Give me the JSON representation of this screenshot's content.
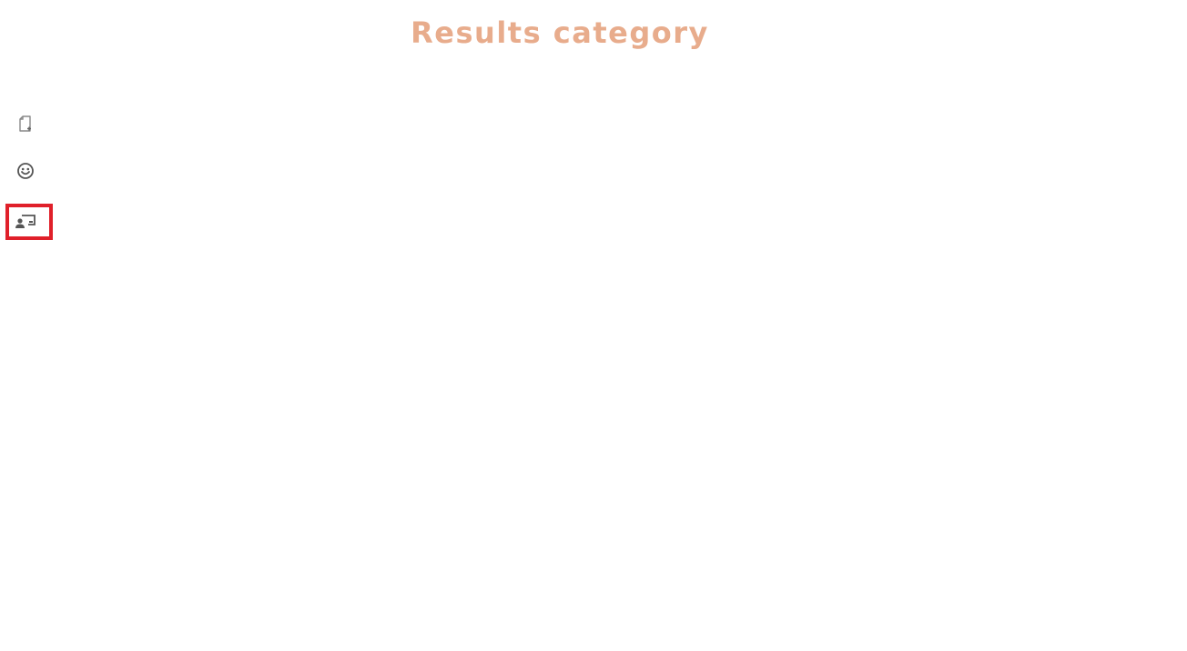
{
  "header": {
    "title": "Results category"
  },
  "sidebar": {
    "items": [
      {
        "id": "new-document",
        "icon": "new-document-icon"
      },
      {
        "id": "emoji",
        "icon": "smiley-icon"
      },
      {
        "id": "presenter",
        "icon": "presenter-screen-icon",
        "selected": true
      }
    ]
  },
  "colors": {
    "title": "#e8ac8c",
    "icon": "#666666",
    "highlight": "#e0202a",
    "background": "#ffffff"
  }
}
